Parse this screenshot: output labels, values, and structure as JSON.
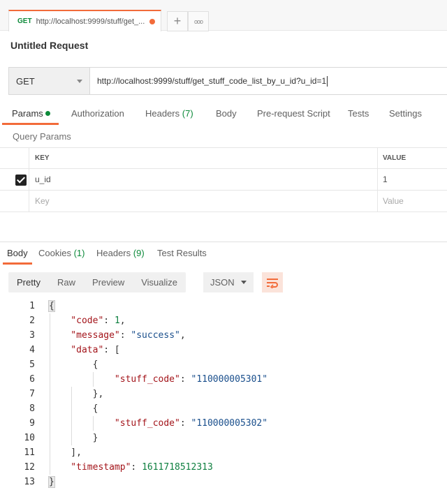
{
  "tab": {
    "method": "GET",
    "title": "http://localhost:9999/stuff/get_..."
  },
  "request": {
    "title": "Untitled Request",
    "method": "GET",
    "url": "http://localhost:9999/stuff/get_stuff_code_list_by_u_id?u_id=1"
  },
  "request_tabs": {
    "params": "Params",
    "authorization": "Authorization",
    "headers": "Headers",
    "headers_count": "(7)",
    "body": "Body",
    "prerequest": "Pre-request Script",
    "tests": "Tests",
    "settings": "Settings"
  },
  "query_params": {
    "title": "Query Params",
    "col_key": "KEY",
    "col_value": "VALUE",
    "rows": [
      {
        "key": "u_id",
        "value": "1",
        "checked": true
      }
    ],
    "key_placeholder": "Key",
    "value_placeholder": "Value"
  },
  "response_tabs": {
    "body": "Body",
    "cookies": "Cookies",
    "cookies_count": "(1)",
    "headers": "Headers",
    "headers_count": "(9)",
    "test_results": "Test Results"
  },
  "view_modes": [
    "Pretty",
    "Raw",
    "Preview",
    "Visualize"
  ],
  "format": "JSON",
  "code_lines": [
    [
      [
        "p",
        "{"
      ]
    ],
    [
      [
        "k",
        "    \"code\""
      ],
      [
        "p",
        ": "
      ],
      [
        "n",
        "1"
      ],
      [
        "p",
        ","
      ]
    ],
    [
      [
        "k",
        "    \"message\""
      ],
      [
        "p",
        ": "
      ],
      [
        "s",
        "\"success\""
      ],
      [
        "p",
        ","
      ]
    ],
    [
      [
        "k",
        "    \"data\""
      ],
      [
        "p",
        ": ["
      ]
    ],
    [
      [
        "p",
        "        {"
      ]
    ],
    [
      [
        "k",
        "            \"stuff_code\""
      ],
      [
        "p",
        ": "
      ],
      [
        "s",
        "\"110000005301\""
      ]
    ],
    [
      [
        "p",
        "        },"
      ]
    ],
    [
      [
        "p",
        "        {"
      ]
    ],
    [
      [
        "k",
        "            \"stuff_code\""
      ],
      [
        "p",
        ": "
      ],
      [
        "s",
        "\"110000005302\""
      ]
    ],
    [
      [
        "p",
        "        }"
      ]
    ],
    [
      [
        "p",
        "    ],"
      ]
    ],
    [
      [
        "k",
        "    \"timestamp\""
      ],
      [
        "p",
        ": "
      ],
      [
        "n",
        "1611718512313"
      ]
    ],
    [
      [
        "p",
        "}"
      ]
    ]
  ],
  "colors": {
    "accent": "#f26b3a",
    "green": "#0d8a3a",
    "json_key": "#a3141a",
    "json_string": "#1a4f8c",
    "json_number": "#0d7f3f"
  }
}
